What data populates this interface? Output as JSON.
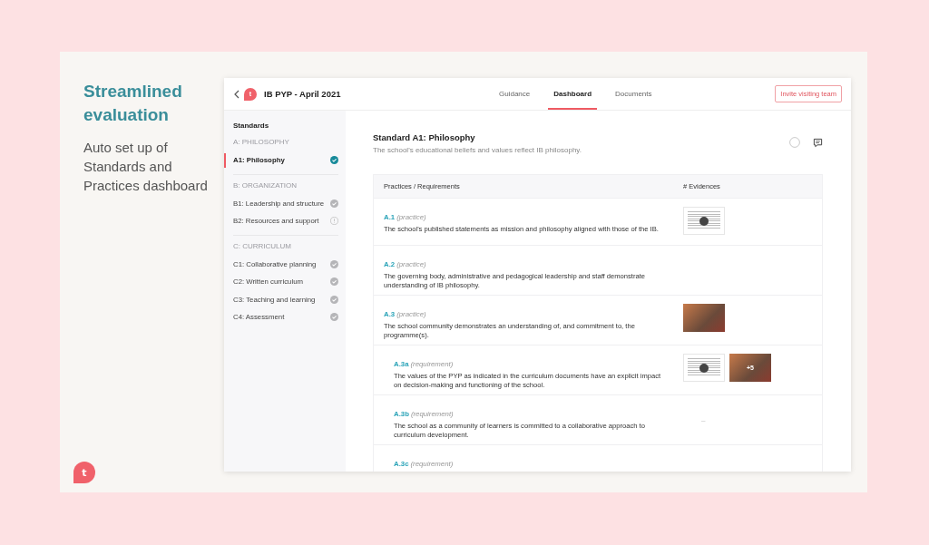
{
  "promo": {
    "heading": "Streamlined evaluation",
    "text": "Auto set up of Standards and Practices dashboard",
    "logo_letter": "t"
  },
  "app": {
    "logo_letter": "t",
    "title": "IB PYP - April 2021",
    "tabs": [
      {
        "label": "Guidance",
        "selected": false
      },
      {
        "label": "Dashboard",
        "selected": true
      },
      {
        "label": "Documents",
        "selected": false
      }
    ],
    "invite_button": "Invite visiting team",
    "sidebar": {
      "title": "Standards",
      "groups": [
        {
          "heading": "A: PHILOSOPHY",
          "items": [
            {
              "label": "A1: Philosophy",
              "selected": true,
              "kind": "done"
            }
          ]
        },
        {
          "heading": "B: ORGANIZATION",
          "items": [
            {
              "label": "B1: Leadership and structure",
              "selected": false,
              "kind": "complete"
            },
            {
              "label": "B2: Resources and support",
              "selected": false,
              "kind": "warning"
            }
          ]
        },
        {
          "heading": "C: CURRICULUM",
          "items": [
            {
              "label": "C1: Collaborative planning",
              "selected": false,
              "kind": "complete"
            },
            {
              "label": "C2: Written curriculum",
              "selected": false,
              "kind": "complete"
            },
            {
              "label": "C3: Teaching and learning",
              "selected": false,
              "kind": "complete"
            },
            {
              "label": "C4: Assessment",
              "selected": false,
              "kind": "complete"
            }
          ]
        }
      ]
    },
    "standard": {
      "title": "Standard A1: Philosophy",
      "description": "The school's educational beliefs and values reflect IB philosophy."
    },
    "table": {
      "columns": [
        "Practices / Requirements",
        "# Evidences"
      ],
      "rows": [
        {
          "code": "A.1",
          "type": "(practice)",
          "kind": "practice",
          "text": "The school's published statements as mission and philosophy aligned with those of the IB.",
          "evidences": [
            {
              "kind": "document"
            }
          ]
        },
        {
          "code": "A.2",
          "type": "(practice)",
          "kind": "practice",
          "text": "The governing body, administrative and pedagogical leadership and staff demonstrate understanding of IB philosophy.",
          "evidences": []
        },
        {
          "code": "A.3",
          "type": "(practice)",
          "kind": "practice",
          "text": "The school community demonstrates an understanding of, and commitment to, the programme(s).",
          "evidences": [
            {
              "kind": "photo"
            }
          ]
        },
        {
          "code": "A.3a",
          "type": "(requirement)",
          "kind": "requirement",
          "text": "The values of the PYP as indicated in the curriculum documents have an explicit impact on decision-making and functioning of the school.",
          "evidences": [
            {
              "kind": "document"
            },
            {
              "kind": "photo",
              "overlay": "+5"
            }
          ]
        },
        {
          "code": "A.3b",
          "type": "(requirement)",
          "kind": "requirement",
          "text": "The school as a community of learners is committed to a collaborative approach to curriculum development.",
          "evidences": [],
          "empty_mark": "–"
        },
        {
          "code": "A.3c",
          "type": "(requirement)",
          "kind": "requirement",
          "evidences": []
        }
      ]
    }
  }
}
